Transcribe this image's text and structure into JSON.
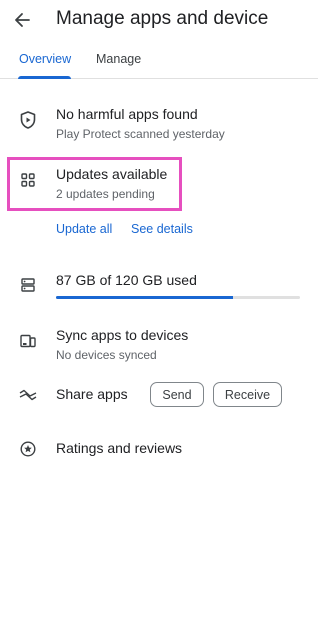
{
  "header": {
    "title": "Manage apps and device",
    "back_icon": "arrow-back-icon"
  },
  "tabs": [
    {
      "label": "Overview",
      "selected": true
    },
    {
      "label": "Manage",
      "selected": false
    }
  ],
  "colors": {
    "accent": "#1967d2",
    "highlight": "#e64fbf",
    "text": "#202124",
    "subtext": "#5f6368"
  },
  "protect": {
    "icon": "shield-play-icon",
    "title": "No harmful apps found",
    "subtitle": "Play Protect scanned yesterday"
  },
  "updates": {
    "icon": "apps-grid-icon",
    "title": "Updates available",
    "subtitle": "2 updates pending",
    "update_all_label": "Update all",
    "see_details_label": "See details"
  },
  "storage": {
    "icon": "storage-icon",
    "label": "87 GB of 120 GB used",
    "used_fraction": 0.725
  },
  "sync": {
    "icon": "devices-icon",
    "title": "Sync apps to devices",
    "subtitle": "No devices synced"
  },
  "share": {
    "icon": "share-apps-icon",
    "title": "Share apps",
    "send_label": "Send",
    "receive_label": "Receive"
  },
  "ratings": {
    "icon": "star-circle-icon",
    "title": "Ratings and reviews"
  }
}
